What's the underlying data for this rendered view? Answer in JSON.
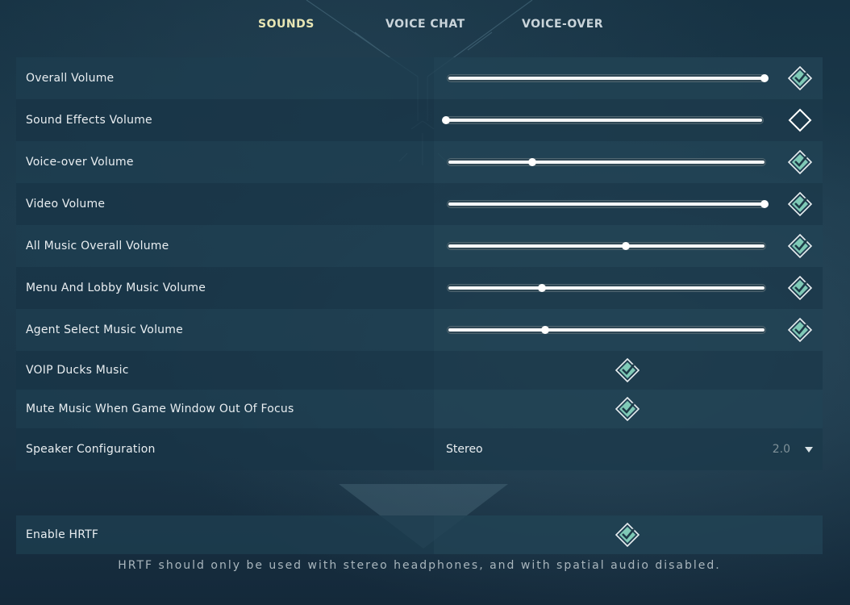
{
  "tabs": [
    {
      "label": "SOUNDS",
      "active": true
    },
    {
      "label": "VOICE CHAT",
      "active": false
    },
    {
      "label": "VOICE-OVER",
      "active": false
    }
  ],
  "sliders": [
    {
      "label": "Overall Volume",
      "value": 1.0,
      "enabled": true
    },
    {
      "label": "Sound Effects Volume",
      "value": 0.0,
      "enabled": false
    },
    {
      "label": "Voice-over Volume",
      "value": 0.265,
      "enabled": true
    },
    {
      "label": "Video Volume",
      "value": 1.0,
      "enabled": true
    },
    {
      "label": "All Music Overall Volume",
      "value": 0.56,
      "enabled": true
    },
    {
      "label": "Menu And Lobby Music Volume",
      "value": 0.295,
      "enabled": true
    },
    {
      "label": "Agent Select Music Volume",
      "value": 0.305,
      "enabled": true
    }
  ],
  "toggles": [
    {
      "label": "VOIP Ducks Music",
      "checked": true
    },
    {
      "label": "Mute Music When Game Window Out Of Focus",
      "checked": true
    }
  ],
  "speaker": {
    "label": "Speaker Configuration",
    "value": "Stereo",
    "detail": "2.0"
  },
  "hrtf": {
    "label": "Enable HRTF",
    "checked": true,
    "note": "HRTF should only be used with stereo headphones, and with spatial audio disabled."
  },
  "colors": {
    "accent_check": "#7fc9b6",
    "active_tab": "#e8e6b4"
  }
}
